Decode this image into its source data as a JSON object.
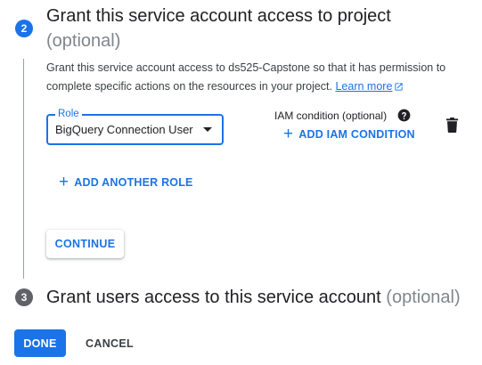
{
  "step2": {
    "number": "2",
    "title": "Grant this service account access to project",
    "optional": "(optional)",
    "description": "Grant this service account access to ds525-Capstone so that it has permission to complete specific actions on the resources in your project.",
    "learn_more": "Learn more"
  },
  "role_field": {
    "label": "Role",
    "value": "BigQuery Connection User"
  },
  "iam": {
    "label": "IAM condition (optional)",
    "add_label": "ADD IAM CONDITION"
  },
  "add_role_label": "ADD ANOTHER ROLE",
  "continue_label": "CONTINUE",
  "step3": {
    "number": "3",
    "title": "Grant users access to this service account",
    "optional": "(optional)"
  },
  "footer": {
    "done_label": "DONE",
    "cancel_label": "CANCEL"
  },
  "colors": {
    "accent": "#1a73e8",
    "inactive_step": "#5f6368"
  },
  "icons": [
    "plus-icon",
    "help-icon",
    "trash-icon",
    "dropdown-icon",
    "external-link-icon"
  ]
}
